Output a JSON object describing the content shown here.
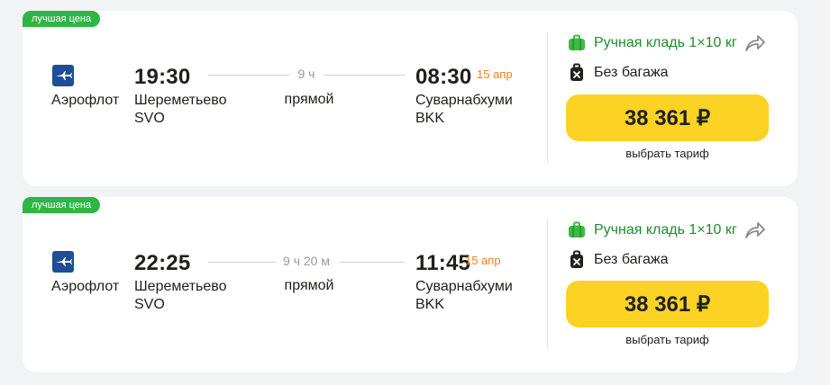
{
  "flights": [
    {
      "badge": "лучшая цена",
      "airline": "Аэрофлот",
      "dep_time": "19:30",
      "dep_city": "Шереметьево",
      "dep_code": "SVO",
      "duration": "9 ч",
      "stops": "прямой",
      "arr_time": "08:30",
      "arr_date": "15 апр",
      "arr_city": "Суварнабхуми",
      "arr_code": "BKK",
      "hand_luggage": "Ручная кладь 1×10 кг",
      "baggage": "Без багажа",
      "price": "38 361 ₽",
      "tariff_label": "выбрать тариф"
    },
    {
      "badge": "лучшая цена",
      "airline": "Аэрофлот",
      "dep_time": "22:25",
      "dep_city": "Шереметьево",
      "dep_code": "SVO",
      "duration": "9 ч 20 м",
      "stops": "прямой",
      "arr_time": "11:45",
      "arr_date": "15 апр",
      "arr_city": "Суварнабхуми",
      "arr_code": "BKK",
      "hand_luggage": "Ручная кладь 1×10 кг",
      "baggage": "Без багажа",
      "price": "38 361 ₽",
      "tariff_label": "выбрать тариф"
    }
  ],
  "colors": {
    "badge": "#2fb546",
    "price_button": "#fcd324",
    "arrival_date": "#e6821e",
    "hand_luggage": "#1f8a2f",
    "airline_logo": "#1d4e96"
  },
  "icons": {
    "airline": "aeroflot-logo-icon",
    "hand_luggage": "green-suitcase-icon",
    "baggage": "no-baggage-icon",
    "share": "share-arrow-icon"
  }
}
